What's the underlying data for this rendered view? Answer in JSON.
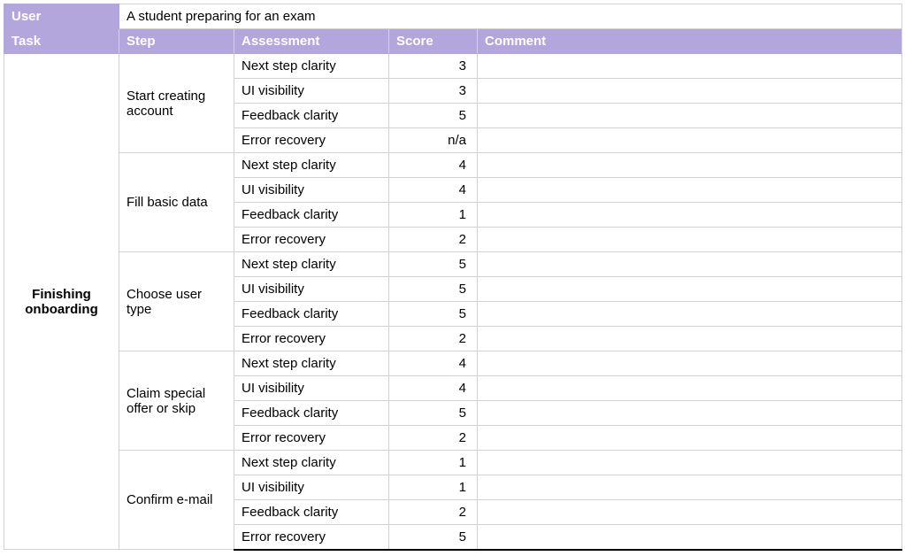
{
  "labels": {
    "user": "User",
    "task": "Task",
    "step": "Step",
    "assessment": "Assessment",
    "score": "Score",
    "comment": "Comment"
  },
  "user_value": "A student preparing for an exam",
  "task": "Finishing onboarding",
  "assessment_types": [
    "Next step clarity",
    "UI visibility",
    "Feedback clarity",
    "Error recovery"
  ],
  "steps": [
    {
      "name": "Start creating account",
      "scores": [
        "3",
        "3",
        "5",
        "n/a"
      ],
      "comments": [
        "",
        "",
        "",
        ""
      ]
    },
    {
      "name": "Fill basic data",
      "scores": [
        "4",
        "4",
        "1",
        "2"
      ],
      "comments": [
        "",
        "",
        "",
        ""
      ]
    },
    {
      "name": "Choose user type",
      "scores": [
        "5",
        "5",
        "5",
        "2"
      ],
      "comments": [
        "",
        "",
        "",
        ""
      ]
    },
    {
      "name": "Claim special offer or skip",
      "scores": [
        "4",
        "4",
        "5",
        "2"
      ],
      "comments": [
        "",
        "",
        "",
        ""
      ]
    },
    {
      "name": "Confirm e-mail",
      "scores": [
        "1",
        "1",
        "2",
        "5"
      ],
      "comments": [
        "",
        "",
        "",
        ""
      ]
    }
  ]
}
